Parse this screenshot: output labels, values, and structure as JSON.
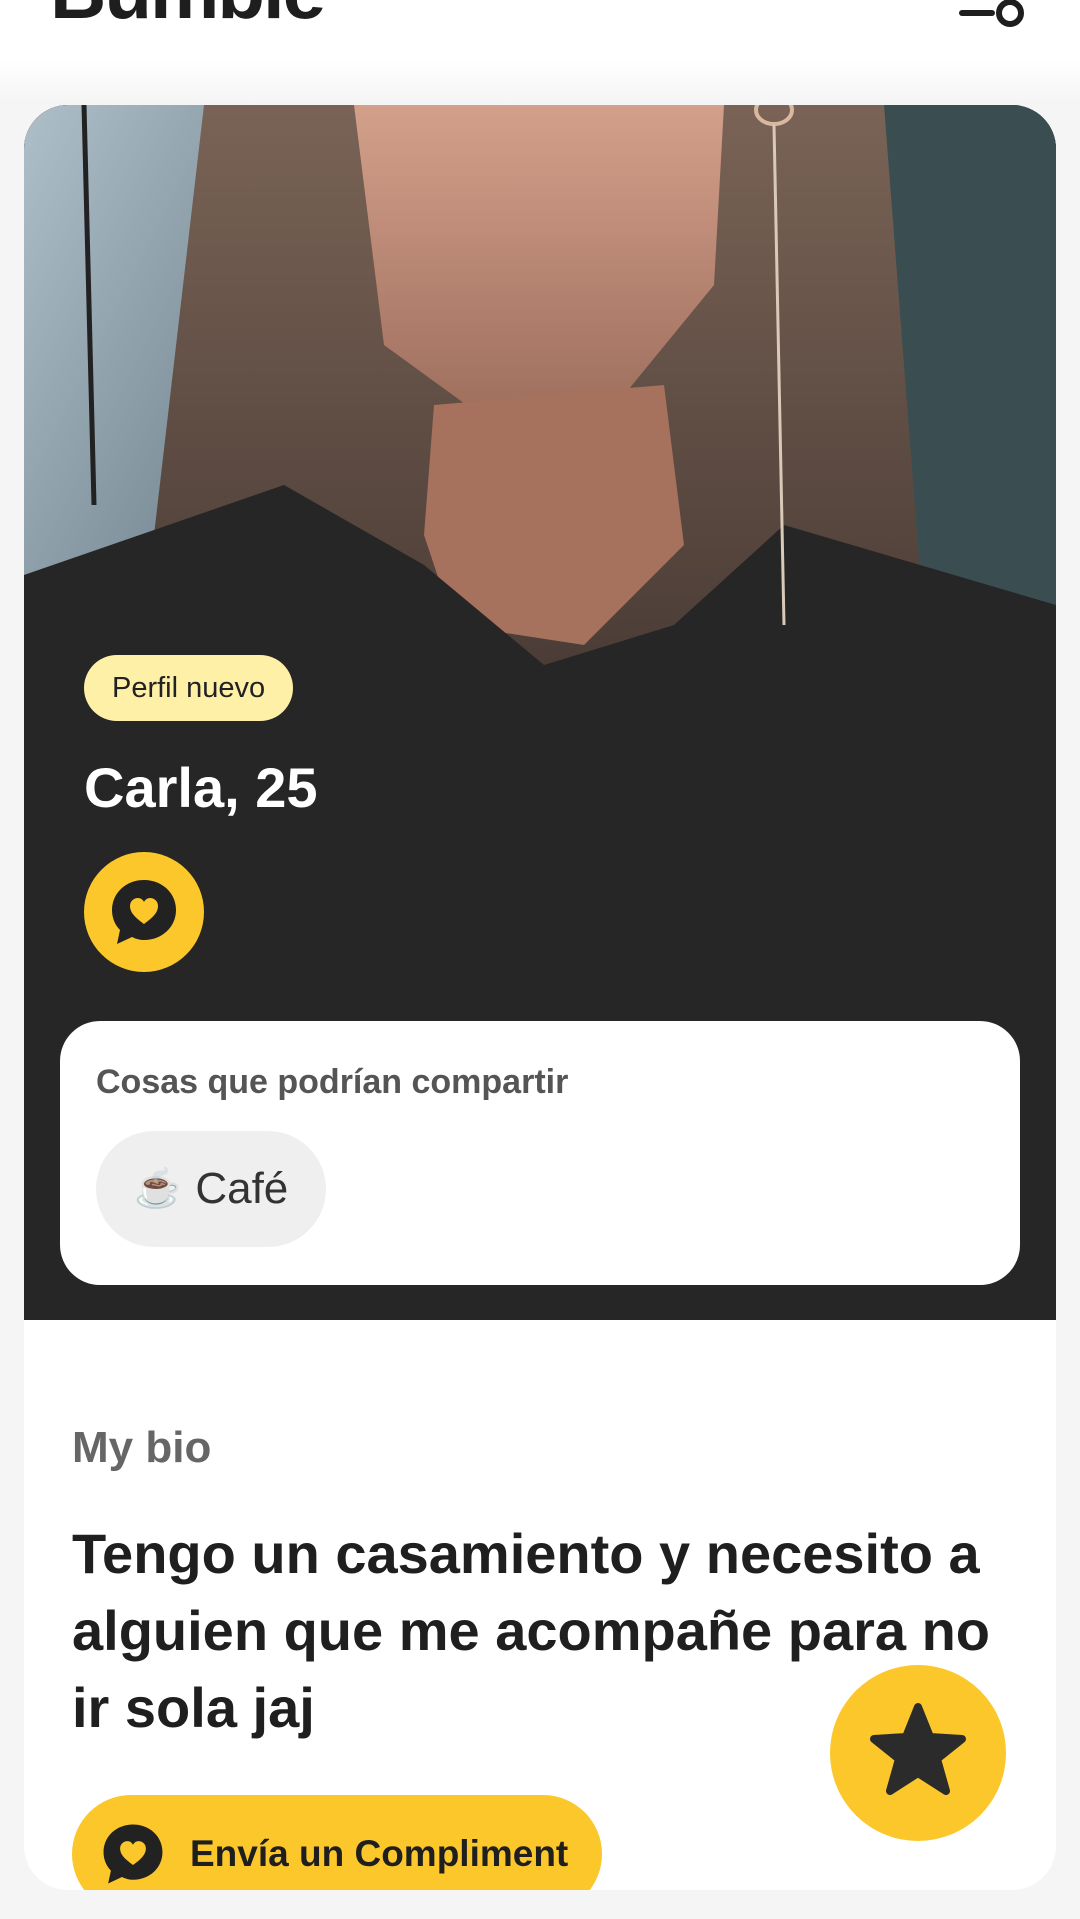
{
  "app": {
    "logo_text": "Bumble"
  },
  "profile": {
    "badge": "Perfil nuevo",
    "name_age": "Carla, 25"
  },
  "share": {
    "title": "Cosas que podrían compartir",
    "chips": [
      {
        "emoji": "☕",
        "label": "Café"
      }
    ]
  },
  "bio": {
    "label": "My bio",
    "text": "Tengo un casamiento y necesito a alguien que me acompañe para no ir sola jaj"
  },
  "actions": {
    "send_compliment": "Envía un Compliment"
  },
  "colors": {
    "accent": "#fcc72b",
    "badge_bg": "#fff0a8",
    "photo_bg": "#2b2b2b"
  },
  "icons": [
    "filter-icon",
    "compliment-heart-bubble-icon",
    "star-icon"
  ]
}
